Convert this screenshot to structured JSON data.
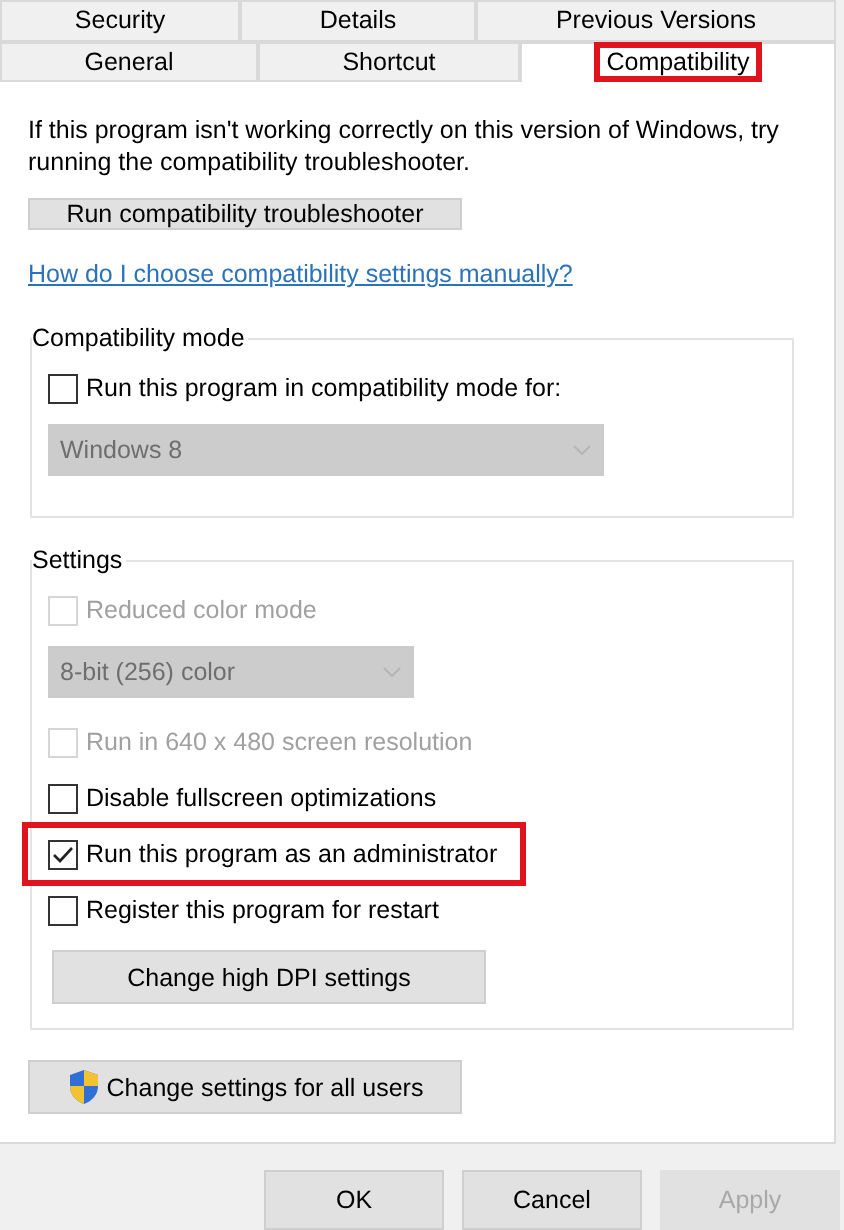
{
  "tab_rows": [
    [
      {
        "label": "Security",
        "selected": false,
        "highlighted": false
      },
      {
        "label": "Details",
        "selected": false,
        "highlighted": false
      },
      {
        "label": "Previous Versions",
        "selected": false,
        "highlighted": false
      }
    ],
    [
      {
        "label": "General",
        "selected": false,
        "highlighted": false
      },
      {
        "label": "Shortcut",
        "selected": false,
        "highlighted": false
      },
      {
        "label": "Compatibility",
        "selected": true,
        "highlighted": true
      }
    ]
  ],
  "intro": "If this program isn't working correctly on this version of Windows, try running the compatibility troubleshooter.",
  "troubleshooter_button": "Run compatibility troubleshooter",
  "help_link": "How do I choose compatibility settings manually?",
  "groups": [
    {
      "title": "Compatibility mode",
      "items": [
        {
          "kind": "checkbox",
          "label": "Run this program in compatibility mode for:",
          "checked": false,
          "disabled": false,
          "highlighted": false
        },
        {
          "kind": "dropdown",
          "value": "Windows 8",
          "disabled": true
        }
      ]
    },
    {
      "title": "Settings",
      "items": [
        {
          "kind": "checkbox",
          "label": "Reduced color mode",
          "checked": false,
          "disabled": true,
          "highlighted": false
        },
        {
          "kind": "dropdown",
          "value": "8-bit (256) color",
          "disabled": true
        },
        {
          "kind": "checkbox",
          "label": "Run in 640 x 480 screen resolution",
          "checked": false,
          "disabled": true,
          "highlighted": false
        },
        {
          "kind": "checkbox",
          "label": "Disable fullscreen optimizations",
          "checked": false,
          "disabled": false,
          "highlighted": false
        },
        {
          "kind": "checkbox",
          "label": "Run this program as an administrator",
          "checked": true,
          "disabled": false,
          "highlighted": true
        },
        {
          "kind": "checkbox",
          "label": "Register this program for restart",
          "checked": false,
          "disabled": false,
          "highlighted": false
        },
        {
          "kind": "button",
          "label": "Change high DPI settings"
        }
      ]
    }
  ],
  "all_users_button": "Change settings for all users",
  "footer_buttons": [
    {
      "label": "OK",
      "disabled": false
    },
    {
      "label": "Cancel",
      "disabled": false
    },
    {
      "label": "Apply",
      "disabled": true
    }
  ]
}
